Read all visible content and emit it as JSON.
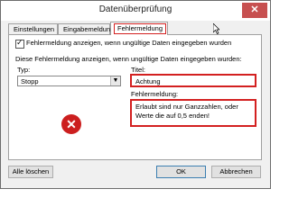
{
  "window": {
    "title": "Datenüberprüfung",
    "close_label": "✕"
  },
  "tabs": [
    {
      "label": "Einstellungen"
    },
    {
      "label": "Eingabemeldung"
    },
    {
      "label": "Fehlermeldung"
    }
  ],
  "checkbox": {
    "label": "Fehlermeldung anzeigen, wenn ungültige Daten eingegeben wurden",
    "checked": true
  },
  "description": "Diese Fehlermeldung anzeigen, wenn ungültige Daten eingegeben wurden:",
  "typ": {
    "label": "Typ:",
    "value": "Stopp"
  },
  "titel": {
    "label": "Titel:",
    "value": "Achtung"
  },
  "fehlermeldung": {
    "label": "Fehlermeldung:",
    "value": "Erlaubt sind nur Ganzzahlen, oder Werte die auf 0,5 enden!"
  },
  "icon": {
    "name": "error-stop-icon",
    "glyph": "✕",
    "color": "#cc1f1f"
  },
  "buttons": {
    "clear_all": "Alle löschen",
    "ok": "OK",
    "cancel": "Abbrechen"
  },
  "accent": {
    "highlight": "#d32020"
  }
}
